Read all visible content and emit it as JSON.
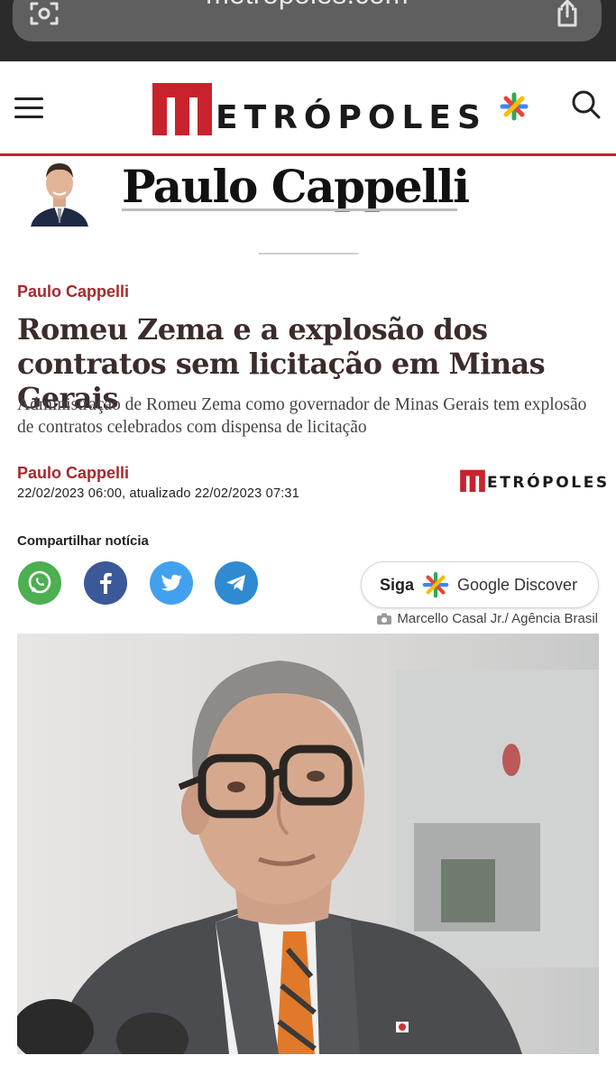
{
  "browser": {
    "url": "metropoles.com",
    "left_icon": "camera-search-icon",
    "right_icon": "share-icon"
  },
  "header": {
    "menu_icon": "hamburger-icon",
    "logo_text": "ETRÓPOLES",
    "search_icon": "search-icon",
    "brand_color": "#c8232c"
  },
  "columnist": {
    "name": "Paulo Cappelli"
  },
  "article": {
    "kicker": "Paulo Cappelli",
    "headline": "Romeu Zema e a explosão dos contratos sem licitação em Minas Gerais",
    "subhead": "Administração de Romeu Zema como governador de Minas Gerais tem explosão de contratos celebrados com dispensa de licitação",
    "author": "Paulo Cappelli",
    "dates": "22/02/2023 06:00, atualizado 22/02/2023 07:31",
    "source_logo_text": "ETRÓPOLES"
  },
  "share": {
    "label": "Compartilhar notícia",
    "buttons": [
      {
        "name": "whatsapp",
        "color": "#4caf50"
      },
      {
        "name": "facebook",
        "color": "#3b5998"
      },
      {
        "name": "twitter",
        "color": "#42a1ee"
      },
      {
        "name": "telegram",
        "color": "#2f8ad2"
      }
    ]
  },
  "follow": {
    "siga": "Siga",
    "service": "Google Discover"
  },
  "photo": {
    "credit": "Marcello Casal Jr./ Agência Brasil"
  }
}
